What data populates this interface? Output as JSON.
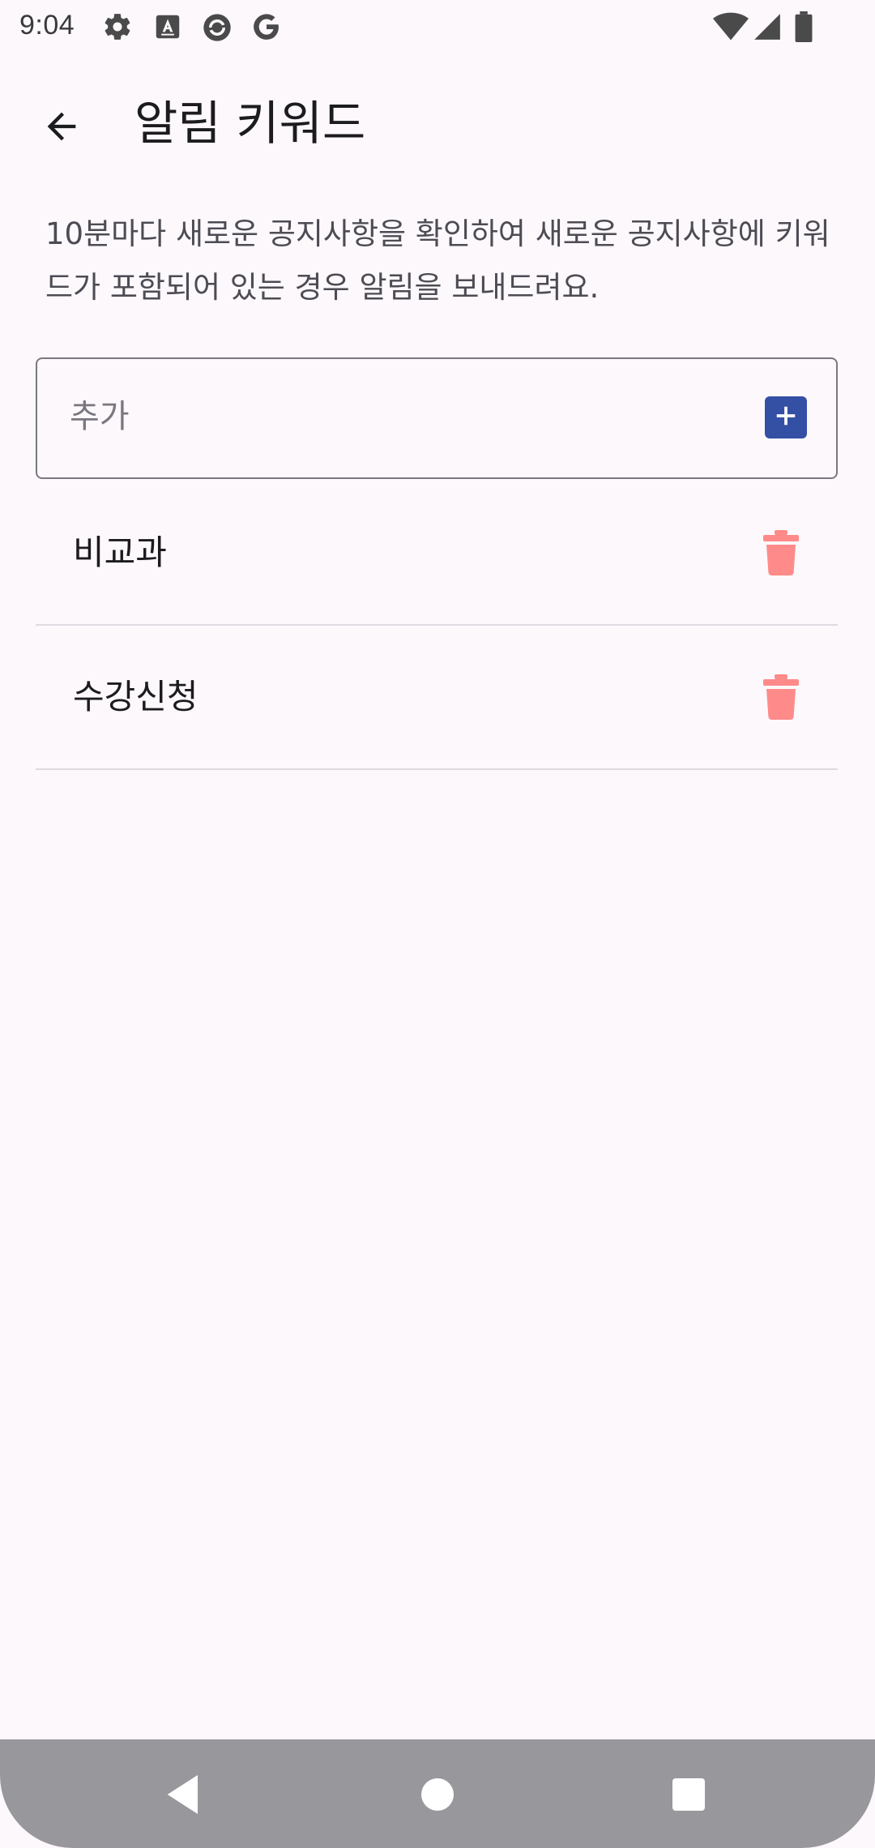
{
  "status_bar": {
    "time": "9:04",
    "left_icons": [
      "gear-icon",
      "font-a-icon",
      "sync-circle-icon",
      "google-g-icon"
    ],
    "right_icons": [
      "wifi-icon",
      "cell-signal-icon",
      "battery-icon"
    ]
  },
  "app_bar": {
    "back_icon": "arrow-left-icon",
    "title": "알림 키워드"
  },
  "description": "10분마다 새로운 공지사항을 확인하여 새로운 공지사항에 키워드가 포함되어 있는 경우 알림을 보내드려요.",
  "add_field": {
    "placeholder": "추가",
    "value": "",
    "button_icon": "plus-square-icon"
  },
  "keywords": [
    {
      "label": "비교과",
      "icon": "trash-icon"
    },
    {
      "label": "수강신청",
      "icon": "trash-icon"
    }
  ],
  "nav_bar": {
    "buttons": [
      "back-triangle-icon",
      "home-circle-icon",
      "recents-square-icon"
    ]
  },
  "colors": {
    "background": "#FCF8FC",
    "accent": "#3450A4",
    "delete": "#FF8A8A",
    "nav_bar": "#98979C"
  }
}
